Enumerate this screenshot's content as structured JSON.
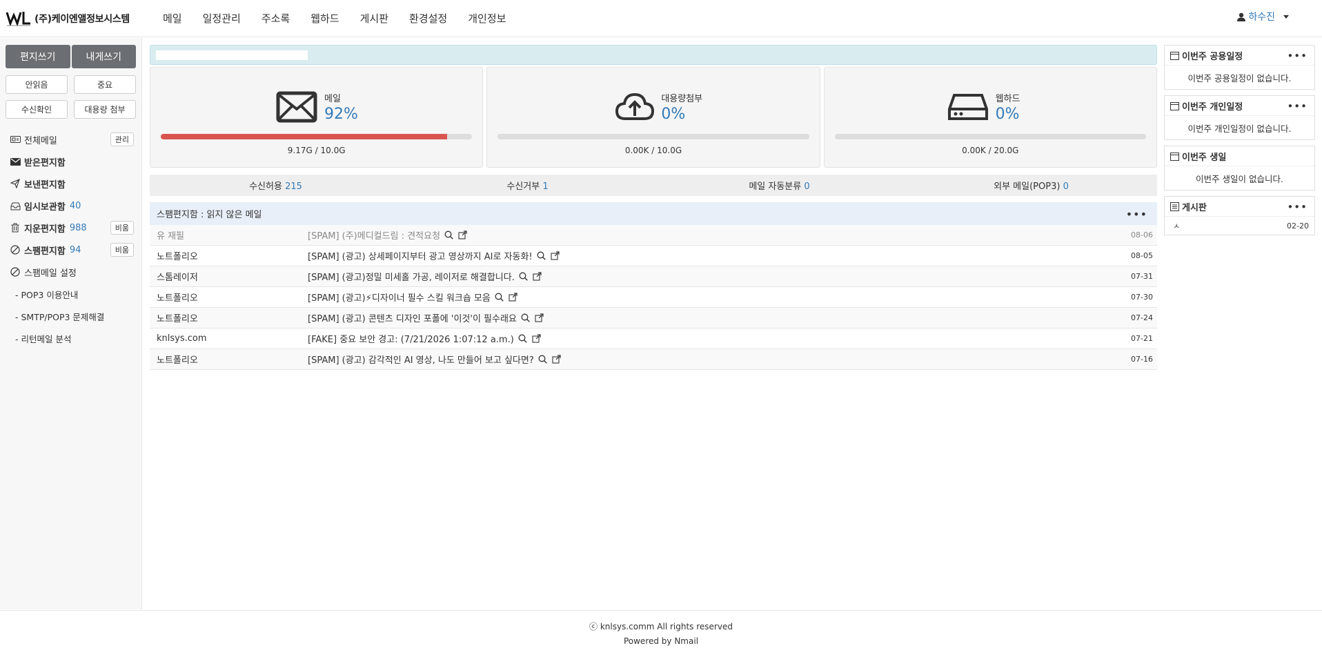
{
  "brand": {
    "name": "(주)케이엔앨정보시스템"
  },
  "nav": {
    "menu": [
      {
        "label": "메일"
      },
      {
        "label": "일정관리"
      },
      {
        "label": "주소록"
      },
      {
        "label": "웹하드"
      },
      {
        "label": "게시판"
      },
      {
        "label": "환경설정"
      },
      {
        "label": "개인정보"
      }
    ],
    "user": "하수진"
  },
  "sidebar": {
    "compose": "편지쓰기",
    "self_compose": "내게쓰기",
    "quick": [
      "안읽음",
      "중요",
      "수신확인",
      "대용량 첨부"
    ],
    "folders": [
      {
        "label": "전체메일",
        "icon": "all-mail-icon",
        "button": "관리"
      },
      {
        "label": "받은편지함",
        "icon": "envelope-icon"
      },
      {
        "label": "보낸편지함",
        "icon": "paper-plane-icon"
      },
      {
        "label": "임시보관함",
        "icon": "inbox-tray-icon",
        "count": "40"
      },
      {
        "label": "지운편지함",
        "icon": "trash-icon",
        "count": "988",
        "button": "비움"
      },
      {
        "label": "스팸편지함",
        "icon": "ban-icon",
        "count": "94",
        "button": "비움"
      },
      {
        "label": "스팸메일 설정",
        "icon": "ban-icon"
      }
    ],
    "links": [
      "- POP3 이용안내",
      "- SMTP/POP3 문제해결",
      "- 리턴메일 분석"
    ]
  },
  "stats": [
    {
      "name": "메일",
      "percent": "92%",
      "usage": "9.17G / 10.0G",
      "fill": 0.92,
      "icon": "mail-envelope-icon"
    },
    {
      "name": "대용량첨부",
      "percent": "0%",
      "usage": "0.00K / 10.0G",
      "fill": 0,
      "icon": "cloud-upload-icon"
    },
    {
      "name": "웹하드",
      "percent": "0%",
      "usage": "0.00K / 20.0G",
      "fill": 0,
      "icon": "hard-drive-icon"
    }
  ],
  "quickbar": [
    {
      "label": "수신허용",
      "num": "215"
    },
    {
      "label": "수신거부",
      "num": "1"
    },
    {
      "label": "메일 자동분류",
      "num": "0"
    },
    {
      "label": "외부 메일(POP3)",
      "num": "0"
    }
  ],
  "spam": {
    "title": "스팸편지함",
    "subtitle": " : 읽지 않은 메일",
    "more": "•••",
    "rows": [
      {
        "from": "유 재필",
        "subject": "[SPAM] (주)메디컬드림 : 견적요청",
        "date": "08-06",
        "read": true
      },
      {
        "from": "노트폴리오",
        "subject": "[SPAM] (광고) 상세페이지부터 광고 영상까지 AI로 자동화!",
        "date": "08-05",
        "read": false
      },
      {
        "from": "스톰레이저",
        "subject": "[SPAM] (광고)정밀 미세홀 가공, 레이저로 해결합니다.",
        "date": "07-31",
        "read": false
      },
      {
        "from": "노트폴리오",
        "subject": "[SPAM] (광고)⚡디자이너 필수 스킬 워크숍 모음",
        "date": "07-30",
        "read": false
      },
      {
        "from": "노트폴리오",
        "subject": "[SPAM] (광고) 콘텐츠 디자인 포폴에 '이것'이 필수래요",
        "date": "07-24",
        "read": false
      },
      {
        "from": "knlsys.com",
        "subject": "[FAKE] 중요 보안 경고: (7/21/2026 1:07:12 a.m.)",
        "date": "07-21",
        "read": false
      },
      {
        "from": "노트폴리오",
        "subject": "[SPAM] (광고) 감각적인 AI 영상, 나도 만들어 보고 싶다면?",
        "date": "07-16",
        "read": false
      }
    ]
  },
  "right": {
    "panels": [
      {
        "title": "이번주 공용일정",
        "body": "이번주 공용일정이 없습니다.",
        "more": "•••"
      },
      {
        "title": "이번주 개인일정",
        "body": "이번주 개인일정이 없습니다.",
        "more": "•••"
      },
      {
        "title": "이번주 생일",
        "body": "이번주 생일이 없습니다."
      }
    ],
    "board": {
      "title": "게시판",
      "more": "•••",
      "item": "ㅅ",
      "date": "02-20"
    }
  },
  "footer": {
    "copyright": "ⓒ knlsys.comm All rights reserved",
    "powered": "Powered by Nmail"
  },
  "colors": {
    "accent": "#337ab7",
    "danger": "#d9534f",
    "button_dark": "#6b6e72"
  }
}
